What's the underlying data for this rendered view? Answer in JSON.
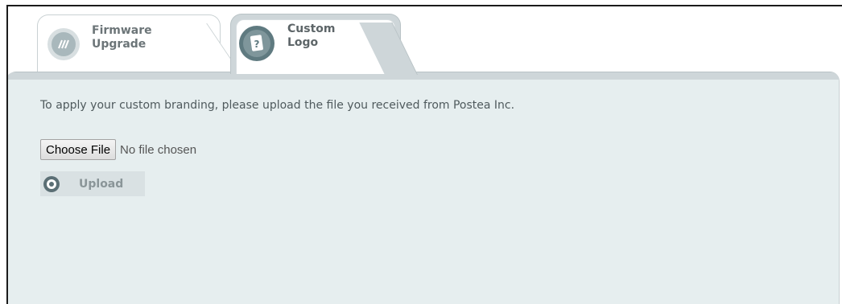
{
  "tabs": [
    {
      "id": "firmware",
      "line1": "Firmware",
      "line2": "Upgrade",
      "icon": "firmware-chip-icon",
      "active": false
    },
    {
      "id": "custom",
      "line1": "Custom",
      "line2": "Logo",
      "icon": "custom-logo-icon",
      "active": true
    }
  ],
  "panel": {
    "instructions": "To apply your custom branding, please upload the file you received from Postea Inc.",
    "file_input": {
      "button_label": "Choose File",
      "status": "No file chosen"
    },
    "upload": {
      "label": "Upload",
      "icon": "upload-icon"
    }
  },
  "colors": {
    "panel_bg": "#e6eeef",
    "active_tab_bg": "#ced6d9",
    "text": "#4f5a5d",
    "upload_bg": "#d9e1e3"
  }
}
